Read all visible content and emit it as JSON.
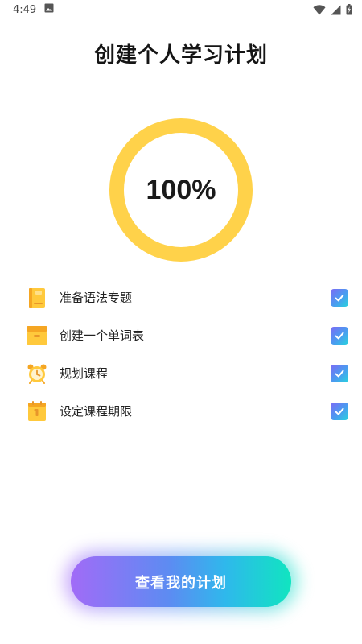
{
  "status_bar": {
    "time": "4:49",
    "icons": [
      "image-icon",
      "wifi-icon",
      "signal-icon",
      "battery-charging-icon"
    ]
  },
  "page": {
    "title": "创建个人学习计划"
  },
  "progress": {
    "label": "100%",
    "value": 100,
    "ring_color": "#FFD24A"
  },
  "tasks": [
    {
      "label": "准备语法专题",
      "icon": "book-icon",
      "checked": true
    },
    {
      "label": "创建一个单词表",
      "icon": "box-icon",
      "checked": true
    },
    {
      "label": "规划课程",
      "icon": "alarm-clock-icon",
      "checked": true
    },
    {
      "label": "设定课程期限",
      "icon": "calendar-icon",
      "checked": true
    }
  ],
  "actions": {
    "view_plan_label": "查看我的计划"
  },
  "colors": {
    "accent_yellow": "#FFD24A",
    "check_gradient": [
      "#7B6BF5",
      "#27D2DE"
    ],
    "button_gradient": [
      "#A16BF7",
      "#10E5C0"
    ]
  }
}
